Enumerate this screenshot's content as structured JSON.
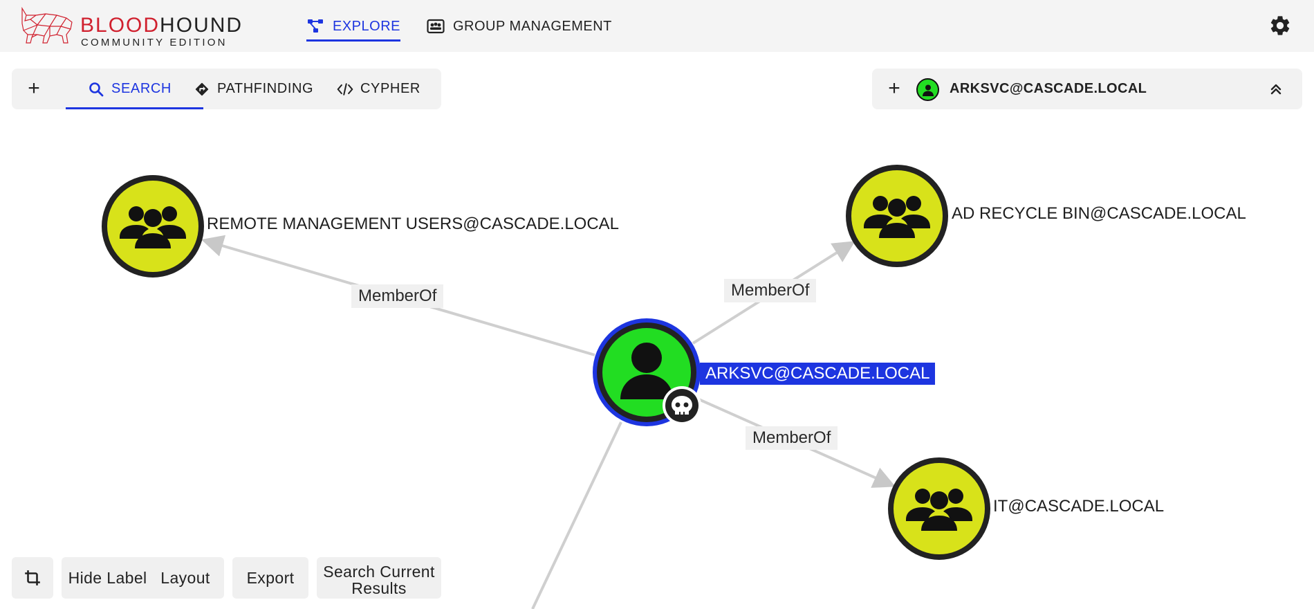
{
  "app": {
    "logo_primary_red": "BLOOD",
    "logo_primary_dark": "HOUND",
    "logo_secondary": "COMMUNITY EDITION"
  },
  "nav": {
    "explore": "EXPLORE",
    "group_management": "GROUP MANAGEMENT"
  },
  "search_panel": {
    "add_symbol": "+",
    "tabs": [
      "SEARCH",
      "PATHFINDING",
      "CYPHER"
    ],
    "active_tab": "SEARCH"
  },
  "node_panel": {
    "add_symbol": "+",
    "selected_node": "ARKSVC@CASCADE.LOCAL"
  },
  "graph": {
    "center_node": "ARKSVC@CASCADE.LOCAL",
    "groups": [
      "REMOTE MANAGEMENT USERS@CASCADE.LOCAL",
      "AD RECYCLE BIN@CASCADE.LOCAL",
      "IT@CASCADE.LOCAL"
    ],
    "edge_label": "MemberOf"
  },
  "bottom_toolbar": {
    "hide_labels": "Hide Labels",
    "layout": "Layout",
    "export": "Export",
    "search_current_results": "Search Current Results"
  },
  "colors": {
    "accent": "#1d35e0",
    "user_node": "#22dd22",
    "group_node": "#d8e21a",
    "brand_red": "#d0202e"
  }
}
